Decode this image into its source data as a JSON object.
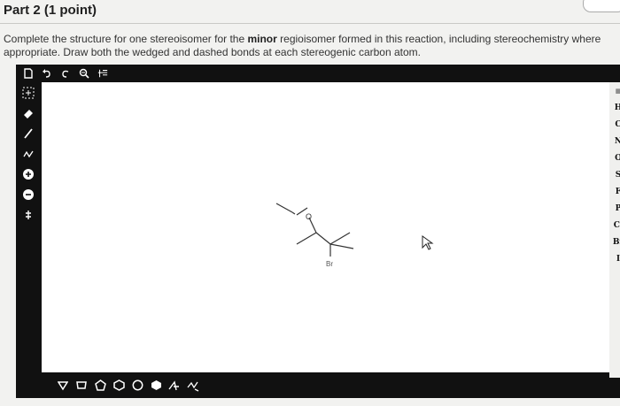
{
  "part": {
    "title": "Part 2  (1 point)"
  },
  "question": {
    "text_before": "Complete the structure for one stereoisomer for the ",
    "emphasis": "minor",
    "text_after": " regioisomer formed in this reaction, including stereochemistry where appropriate. Draw both the wedged and dashed bonds at each stereogenic carbon atom."
  },
  "editor": {
    "top_tools": [
      "new-document-icon",
      "undo-icon",
      "redo-icon",
      "zoom-icon",
      "grid-icon"
    ],
    "left_tools": [
      "select-icon",
      "eraser-icon",
      "single-bond-icon",
      "chain-icon",
      "positive-charge-icon",
      "negative-charge-icon",
      "lone-pair-icon"
    ],
    "atoms": [
      "H",
      "C",
      "N",
      "O",
      "S",
      "F",
      "P",
      "Cl",
      "Br",
      "I"
    ],
    "bottom_tools": [
      "triangle-icon",
      "pentagon-icon",
      "hexagon-icon",
      "heptagon-icon",
      "benzene-icon",
      "cyclohexane-icon",
      "template-icon"
    ],
    "molecule_labels": {
      "oxygen": "O",
      "bromine": "Br"
    }
  },
  "colors": {
    "editor_frame": "#111111",
    "canvas": "#ffffff",
    "text": "#333333"
  }
}
